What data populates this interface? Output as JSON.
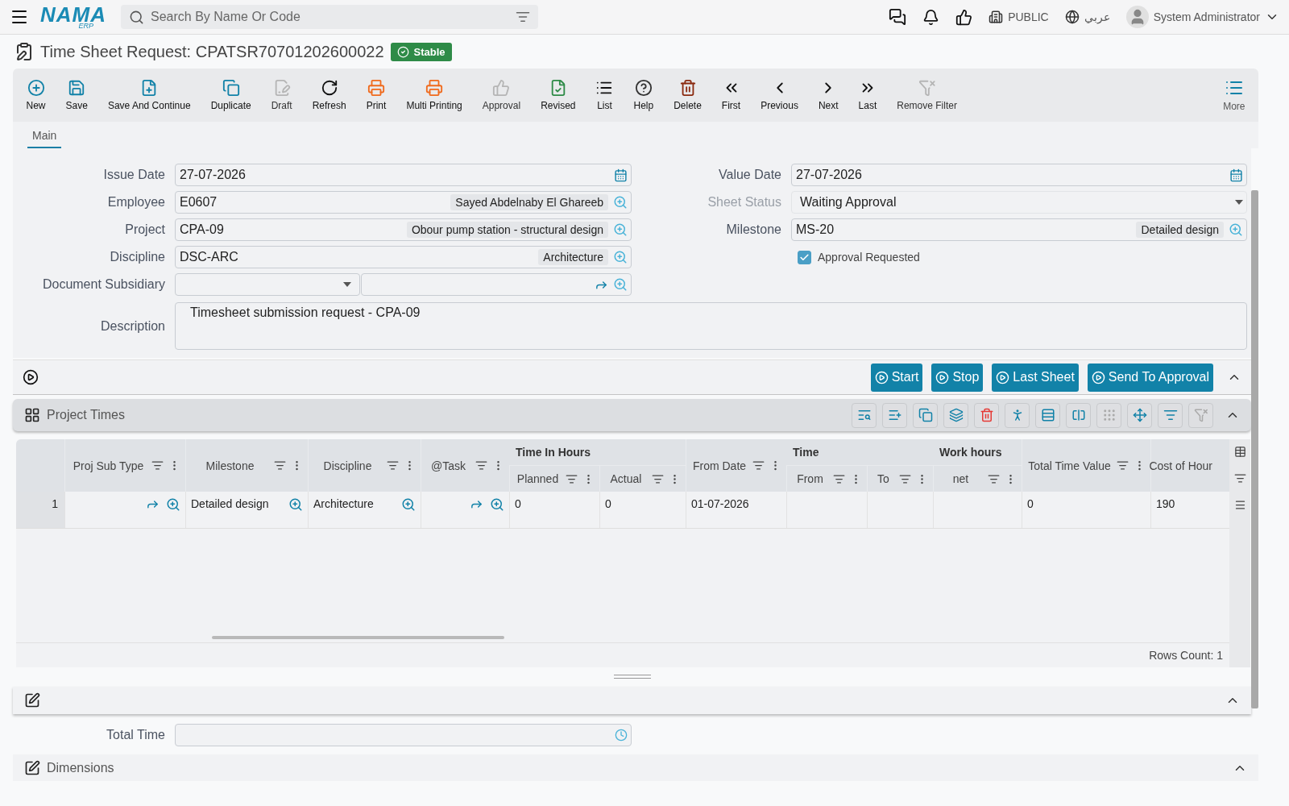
{
  "top_bar": {
    "logo": {
      "name": "NAMA",
      "sub": "ERP"
    },
    "search": {
      "placeholder": "Search By Name Or Code"
    },
    "company": "PUBLIC",
    "language": "عربي",
    "user": "System Administrator"
  },
  "page_title": {
    "title": "Time Sheet Request: CPATSR70701202600022",
    "status": "Stable"
  },
  "toolbar": [
    {
      "kind": "new",
      "label": "New",
      "disabled": false
    },
    {
      "kind": "save",
      "label": "Save",
      "disabled": false
    },
    {
      "kind": "save-continue",
      "label": "Save And Continue",
      "disabled": false
    },
    {
      "kind": "duplicate",
      "label": "Duplicate",
      "disabled": false
    },
    {
      "kind": "draft",
      "label": "Draft",
      "disabled": true
    },
    {
      "kind": "refresh",
      "label": "Refresh",
      "disabled": false
    },
    {
      "kind": "print",
      "label": "Print",
      "disabled": false
    },
    {
      "kind": "multi-print",
      "label": "Multi Printing",
      "disabled": false
    },
    {
      "kind": "approval",
      "label": "Approval",
      "disabled": true
    },
    {
      "kind": "revised",
      "label": "Revised",
      "disabled": false
    },
    {
      "kind": "list",
      "label": "List",
      "disabled": false
    },
    {
      "kind": "help",
      "label": "Help",
      "disabled": false
    },
    {
      "kind": "delete",
      "label": "Delete",
      "disabled": false
    },
    {
      "kind": "first",
      "label": "First",
      "disabled": false
    },
    {
      "kind": "previous",
      "label": "Previous",
      "disabled": false
    },
    {
      "kind": "next",
      "label": "Next",
      "disabled": false
    },
    {
      "kind": "last",
      "label": "Last",
      "disabled": false
    },
    {
      "kind": "remove-filter",
      "label": "Remove Filter",
      "disabled": true
    }
  ],
  "more": {
    "label": "More"
  },
  "tabs": [
    {
      "label": "Main",
      "selected": true
    }
  ],
  "form": {
    "left": [
      {
        "label": "Issue Date",
        "kind": "date",
        "value": "27-07-2026",
        "disabled": false
      },
      {
        "label": "Employee",
        "kind": "lookup",
        "value": "E0607",
        "tag": "Sayed Abdelnaby El Ghareeb",
        "disabled": false
      },
      {
        "label": "Project",
        "kind": "lookup",
        "value": "CPA-09",
        "tag": "Obour pump station - structural design",
        "disabled": false
      },
      {
        "label": "Discipline",
        "kind": "lookup",
        "value": "DSC-ARC",
        "tag": "Architecture",
        "disabled": false
      },
      {
        "label": "Document Subsidiary",
        "kind": "subsidiary",
        "disabled": false
      }
    ],
    "right": [
      {
        "label": "Value Date",
        "kind": "date",
        "value": "27-07-2026",
        "disabled": false
      },
      {
        "label": "Sheet Status",
        "kind": "select",
        "value": "Waiting Approval",
        "disabled": true
      },
      {
        "label": "Milestone",
        "kind": "lookup",
        "value": "MS-20",
        "tag": "Detailed design",
        "disabled": false
      },
      {
        "label": "Approval Requested",
        "kind": "checkbox",
        "checked": true,
        "disabled": false
      }
    ],
    "description": {
      "label": "Description",
      "value": "Timesheet submission request - CPA-09"
    }
  },
  "actions": [
    "Start",
    "Stop",
    "Last Sheet",
    "Send To Approval"
  ],
  "project_times": {
    "title": "Project Times",
    "columns": [
      {
        "label": "Proj Sub Type"
      },
      {
        "label": "Milestone"
      },
      {
        "label": "Discipline"
      },
      {
        "label": "@Task"
      },
      {
        "label": "Planned",
        "group": "Time In Hours"
      },
      {
        "label": "Actual",
        "grouped": true
      },
      {
        "label": "From Date"
      },
      {
        "label": "From",
        "group": "Time"
      },
      {
        "label": "To",
        "grouped": true
      },
      {
        "label": "net",
        "group": "Work hours"
      },
      {
        "label": "Total Time Value"
      },
      {
        "label": "Cost of Hour"
      }
    ],
    "rows": [
      {
        "number": "1",
        "cells": [
          {
            "kind": "link-lookup"
          },
          {
            "kind": "lookup",
            "text": "Detailed design"
          },
          {
            "kind": "lookup",
            "text": "Architecture"
          },
          {
            "kind": "link-lookup"
          },
          {
            "kind": "plain",
            "text": "0"
          },
          {
            "kind": "plain",
            "text": "0"
          },
          {
            "kind": "plain",
            "text": "01-07-2026"
          },
          {
            "kind": "plain"
          },
          {
            "kind": "plain"
          },
          {
            "kind": "plain"
          },
          {
            "kind": "plain",
            "text": "0"
          },
          {
            "kind": "plain",
            "text": "190"
          }
        ]
      }
    ],
    "rows_count": "Rows Count: 1"
  },
  "total_time": {
    "label": "Total Time"
  },
  "dimensions": {
    "title": "Dimensions"
  }
}
